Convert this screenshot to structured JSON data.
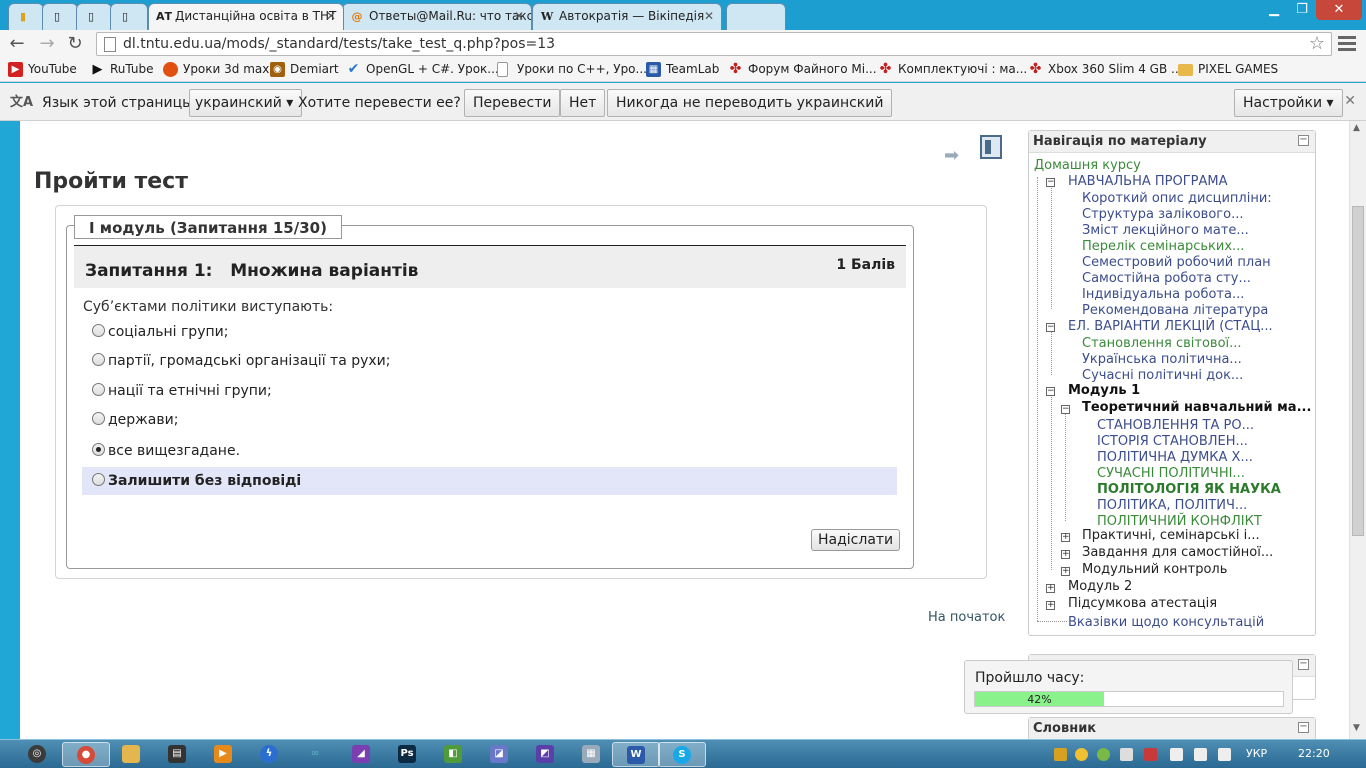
{
  "tabs": [
    {
      "label": "Дистанційна освіта в ТНТ",
      "icon": "at-icon"
    },
    {
      "label": "Ответы@Mail.Ru: что такс",
      "icon": "mail-icon"
    },
    {
      "label": "Автократія — Вікіпедія",
      "icon": "wikipedia-icon"
    }
  ],
  "tab_icons_fav": [
    "АТ",
    "@",
    "W"
  ],
  "address": {
    "url": "dl.tntu.edu.ua/mods/_standard/tests/take_test_q.php?pos=13"
  },
  "bookmarks": [
    {
      "label": "YouTube",
      "color": "#d32020"
    },
    {
      "label": "RuTube",
      "color": "#222222"
    },
    {
      "label": "Уроки 3d max",
      "color": "#e05010"
    },
    {
      "label": "Demiart",
      "color": "#a06010"
    },
    {
      "label": "OpenGL + C#. Урок...",
      "color": "#2a78c8"
    },
    {
      "label": "Уроки по C++, Уро...",
      "color": "#888888"
    },
    {
      "label": "TeamLab",
      "color": "#2a5aa8"
    },
    {
      "label": "Форум Файного Мі...",
      "color": "#c02020"
    },
    {
      "label": "Комплектуючі : ма...",
      "color": "#c02020"
    },
    {
      "label": "Xbox 360 Slim 4 GB ...",
      "color": "#c02020"
    },
    {
      "label": "PIXEL GAMES",
      "color": "#e8b84a"
    }
  ],
  "translate": {
    "lang_prompt": "Язык этой страницы",
    "lang_value": "украинский ▾",
    "question": "Хотите перевести ее?",
    "translate_btn": "Перевести",
    "no_btn": "Нет",
    "never_btn": "Никогда не переводить украинский",
    "settings_btn": "Настройки ▾"
  },
  "page": {
    "title": "Пройти тест",
    "legend": "І модуль (Запитання 15/30)",
    "question_title": "Запитання 1:   Множина варіантів",
    "grade": "1 Балів",
    "question_text": "Суб’єктами політики виступають:",
    "options": [
      {
        "label": "соціальні групи;",
        "checked": false
      },
      {
        "label": "партії, громадські організації та рухи;",
        "checked": false
      },
      {
        "label": "нації та етнічні групи;",
        "checked": false
      },
      {
        "label": "держави;",
        "checked": false
      },
      {
        "label": "все вищезгадане.",
        "checked": true
      },
      {
        "label": "Залишити без відповіді",
        "checked": false
      }
    ],
    "submit": "Надіслати",
    "to_top": "На початок"
  },
  "sidebar": {
    "nav_title": "Навігація по матеріалу",
    "home": "Домашня курсу",
    "items": [
      {
        "label": "НАВЧАЛЬНА ПРОГРАМА",
        "style": "link"
      },
      {
        "label": "Короткий опис дисципліни:",
        "style": "link"
      },
      {
        "label": "Структура залікового...",
        "style": "link"
      },
      {
        "label": "Зміст лекційного мате...",
        "style": "link"
      },
      {
        "label": "Перелік семінарських...",
        "style": "green"
      },
      {
        "label": "Семестровий робочий план",
        "style": "link"
      },
      {
        "label": "Самостійна робота сту...",
        "style": "link"
      },
      {
        "label": "Індивідуальна робота...",
        "style": "link"
      },
      {
        "label": "Рекомендована література",
        "style": "link"
      },
      {
        "label": "ЕЛ. ВАРІАНТИ ЛЕКЦІЙ (СТАЦ...",
        "style": "link"
      },
      {
        "label": "Становлення світової...",
        "style": "green"
      },
      {
        "label": "Українська політична...",
        "style": "link"
      },
      {
        "label": "Сучасні політичні док...",
        "style": "link"
      },
      {
        "label": "Модуль 1",
        "style": "bold"
      },
      {
        "label": "Теоретичний навчальний ма...",
        "style": "bold"
      },
      {
        "label": "СТАНОВЛЕННЯ ТА РО...",
        "style": "link"
      },
      {
        "label": "ІСТОРІЯ СТАНОВЛЕН...",
        "style": "link"
      },
      {
        "label": "ПОЛІТИЧНА ДУМКА Х...",
        "style": "link"
      },
      {
        "label": "СУЧАСНІ ПОЛІТИЧНІ...",
        "style": "green"
      },
      {
        "label": "ПОЛІТОЛОГІЯ ЯК НАУКА",
        "style": "greenbold"
      },
      {
        "label": "ПОЛІТИКА, ПОЛІТИЧ...",
        "style": "link"
      },
      {
        "label": "ПОЛІТИЧНИЙ КОНФЛІКТ",
        "style": "green"
      },
      {
        "label": "Практичні, семінарські і...",
        "style": "plain"
      },
      {
        "label": "Завдання для самостійної...",
        "style": "plain"
      },
      {
        "label": "Модульний контроль",
        "style": "plain"
      },
      {
        "label": "Модуль 2",
        "style": "plain"
      },
      {
        "label": "Підсумкова атестація",
        "style": "plain"
      },
      {
        "label": "Вказівки щодо консультацій",
        "style": "link"
      }
    ],
    "dictionary_title": "Словник"
  },
  "timer": {
    "label": "Пройшло часу:",
    "percent": 42,
    "percent_label": "42%"
  },
  "taskbar": {
    "lang": "УКР",
    "time": "22:20"
  }
}
